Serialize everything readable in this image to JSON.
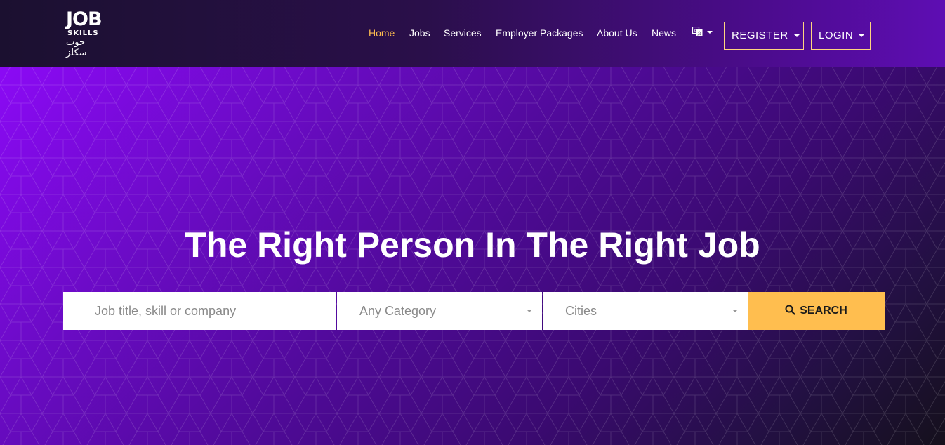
{
  "logo": {
    "top": "JOB",
    "mid": "SKILLS",
    "arabic": "جوب سكلز"
  },
  "nav": {
    "items": [
      {
        "label": "Home",
        "active": true
      },
      {
        "label": "Jobs"
      },
      {
        "label": "Services"
      },
      {
        "label": "Employer Packages"
      },
      {
        "label": "About Us"
      },
      {
        "label": "News"
      }
    ],
    "language_icon": "translate-icon",
    "register_label": "REGISTER",
    "login_label": "LOGIN"
  },
  "hero": {
    "title": "The Right Person In The Right Job"
  },
  "search": {
    "keyword_placeholder": "Job title, skill or company",
    "category_selected": "Any Category",
    "city_selected": "Cities",
    "button_label": "SEARCH",
    "button_icon": "search-icon"
  },
  "colors": {
    "accent": "#ffbe4f",
    "purple": "#8b0af5",
    "dark": "#1b1030"
  }
}
